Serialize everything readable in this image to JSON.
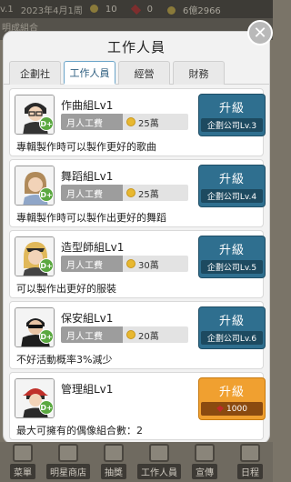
{
  "hud": {
    "left_text": "v.1",
    "date": "2023年4月1周",
    "coins": "10",
    "rubies": "0",
    "fans": "6億2966",
    "sub_left": "明成組合"
  },
  "dialog": {
    "title": "工作人員",
    "close_symbol": "✕"
  },
  "tabs": [
    {
      "label": "企劃社",
      "active": false
    },
    {
      "label": "工作人員",
      "active": true
    },
    {
      "label": "經營",
      "active": false
    },
    {
      "label": "財務",
      "active": false
    }
  ],
  "staff": [
    {
      "name": "作曲組Lv1",
      "salary_label": "月人工費",
      "salary_value": "25萬",
      "description": "專輯製作時可以製作更好的歌曲",
      "button_label": "升級",
      "requirement": "企劃公司Lv.3",
      "badge": "D+"
    },
    {
      "name": "舞蹈組Lv1",
      "salary_label": "月人工費",
      "salary_value": "25萬",
      "description": "專輯製作時可以製作出更好的舞蹈",
      "button_label": "升級",
      "requirement": "企劃公司Lv.4",
      "badge": "D+"
    },
    {
      "name": "造型師組Lv1",
      "salary_label": "月人工費",
      "salary_value": "30萬",
      "description": "可以製作出更好的服裝",
      "button_label": "升級",
      "requirement": "企劃公司Lv.5",
      "badge": "D+"
    },
    {
      "name": "保安組Lv1",
      "salary_label": "月人工費",
      "salary_value": "20萬",
      "description": "不好活動概率3%減少",
      "button_label": "升級",
      "requirement": "企劃公司Lv.6",
      "badge": "D+"
    },
    {
      "name": "管理組Lv1",
      "description": "最大可擁有的偶像組合數：2",
      "button_label": "升級",
      "cost": "1000",
      "badge": "D+"
    }
  ],
  "bottom_nav": [
    {
      "label": "菜單",
      "icon": "menu-icon"
    },
    {
      "label": "明星商店",
      "icon": "star-icon"
    },
    {
      "label": "抽獎",
      "icon": "gift-icon"
    },
    {
      "label": "工作人員",
      "icon": "staff-icon"
    },
    {
      "label": "宣傳",
      "icon": "megaphone-icon"
    },
    {
      "label": "日程",
      "icon": "calendar-icon"
    }
  ],
  "colors": {
    "upgrade_blue": "#2f6f8f",
    "upgrade_gold": "#f0a030",
    "badge_green": "#5aa840"
  }
}
